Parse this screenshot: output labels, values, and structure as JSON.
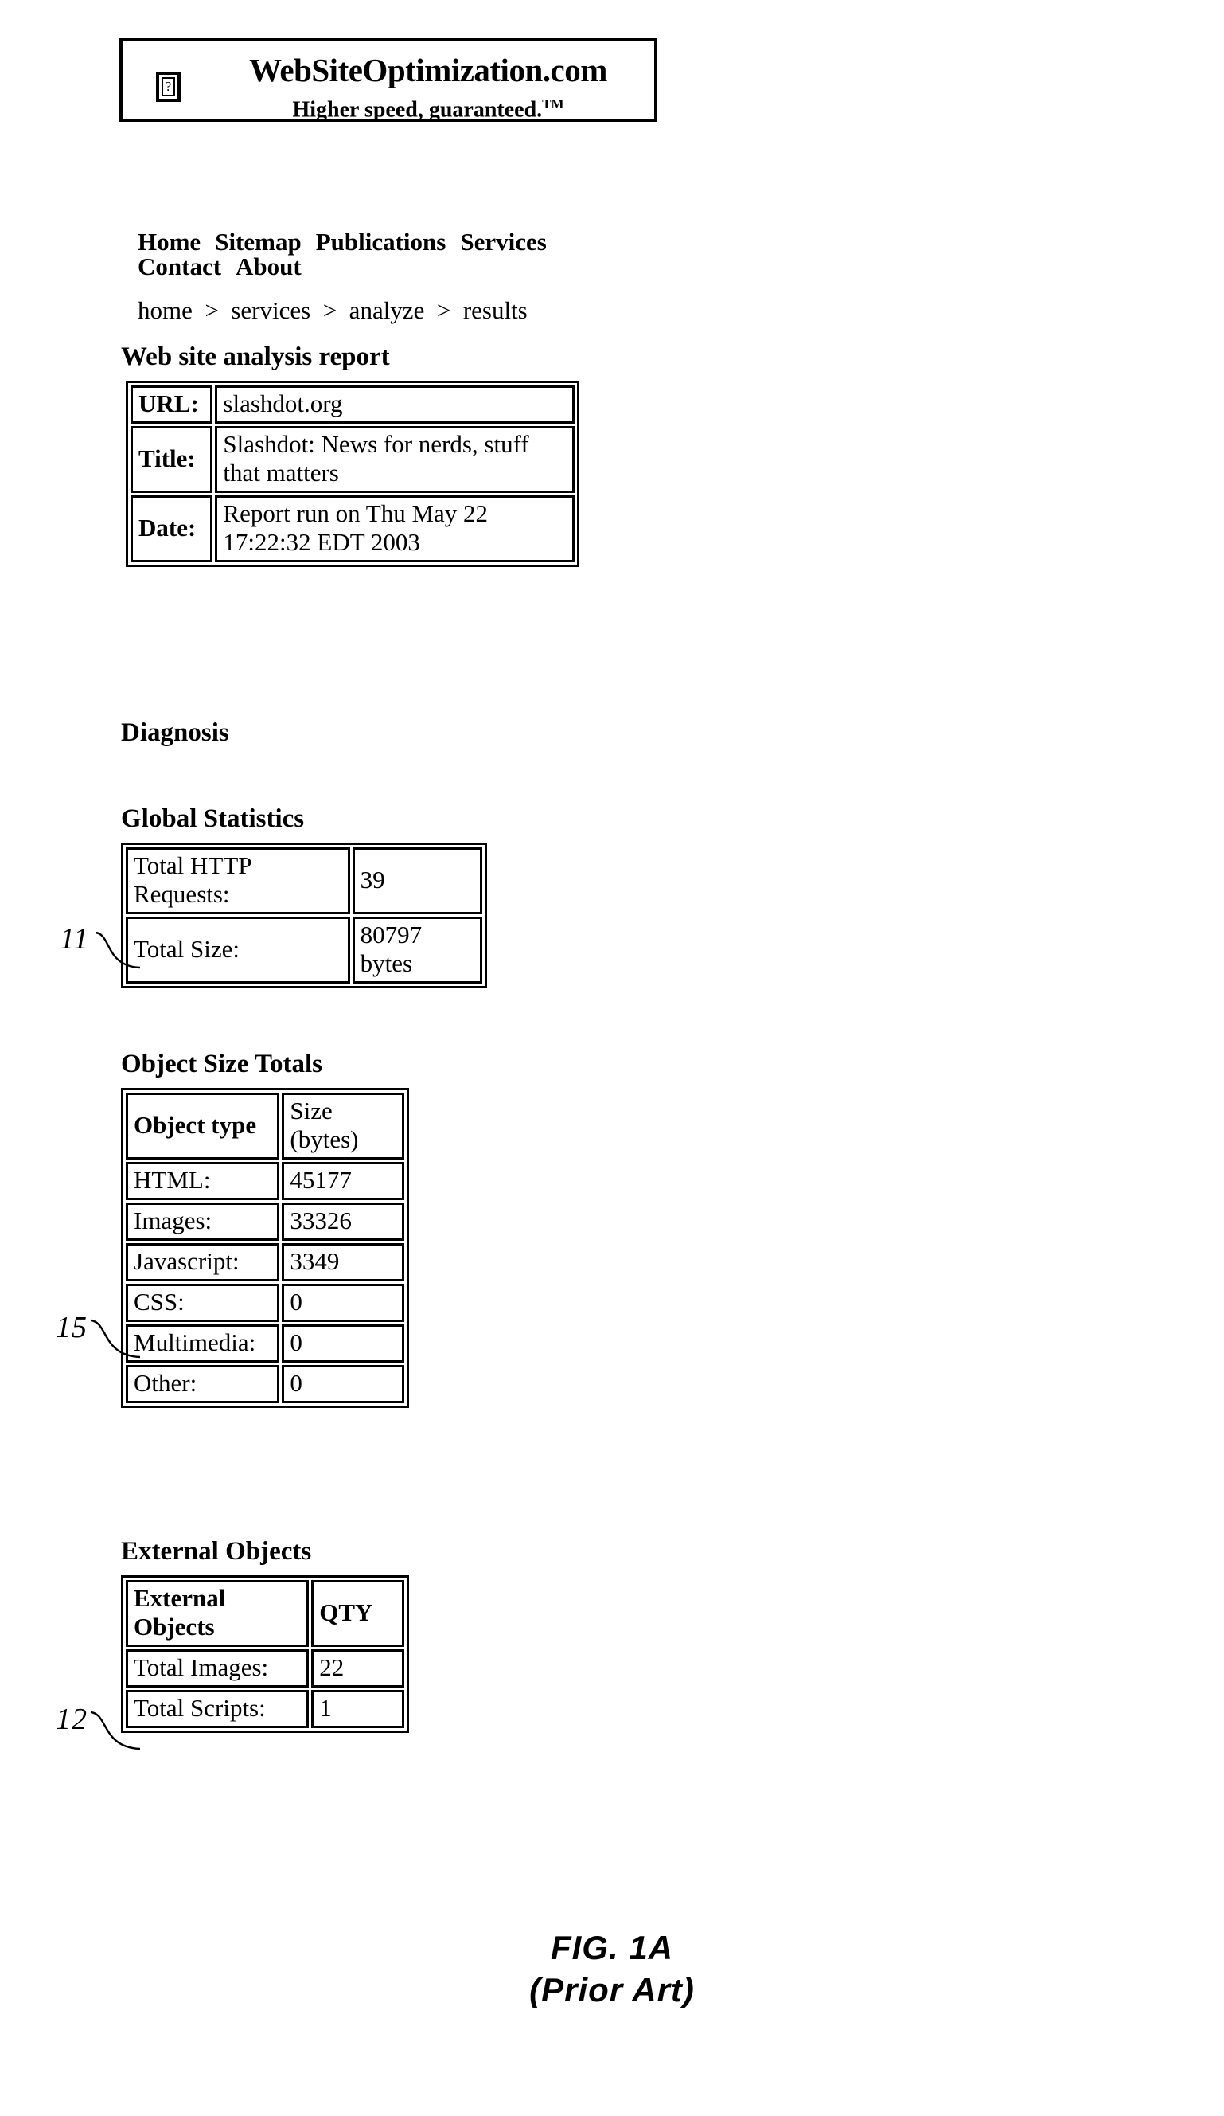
{
  "figure": {
    "label": "FIG. 1A",
    "sublabel": "(Prior Art)"
  },
  "banner": {
    "logo_icon": "broken-image-placeholder-icon",
    "logo_glyph": "?",
    "title": "WebSiteOptimization.com",
    "tagline": "Higher speed, guaranteed.",
    "tagline_mark": "TM"
  },
  "nav": {
    "items": [
      {
        "label": "Home"
      },
      {
        "label": "Sitemap"
      },
      {
        "label": "Publications"
      },
      {
        "label": "Services"
      },
      {
        "label": "Contact"
      },
      {
        "label": "About"
      }
    ]
  },
  "breadcrumb": {
    "text": "home  >  services  >  analyze  >  results",
    "items": [
      "home",
      "services",
      "analyze",
      "results"
    ],
    "separator": ">"
  },
  "headings": {
    "report": "Web site analysis report",
    "diagnosis": "Diagnosis",
    "global_statistics": "Global Statistics",
    "object_size_totals": "Object Size Totals",
    "external_objects": "External Objects"
  },
  "report_table": {
    "rows": [
      {
        "key": "URL:",
        "value": "slashdot.org"
      },
      {
        "key": "Title:",
        "value": "Slashdot: News for nerds, stuff that matters"
      },
      {
        "key": "Date:",
        "value": "Report run on Thu May 22 17:22:32 EDT 2003"
      }
    ]
  },
  "global_statistics": {
    "ref": "11",
    "rows": [
      {
        "key": "Total HTTP Requests:",
        "value": "39"
      },
      {
        "key": "Total Size:",
        "value": "80797 bytes"
      }
    ]
  },
  "object_size_totals": {
    "ref": "15",
    "header": {
      "key": "Object type",
      "value": "Size (bytes)"
    },
    "rows": [
      {
        "key": "HTML:",
        "value": "45177"
      },
      {
        "key": "Images:",
        "value": "33326"
      },
      {
        "key": "Javascript:",
        "value": "3349"
      },
      {
        "key": "CSS:",
        "value": "0"
      },
      {
        "key": "Multimedia:",
        "value": "0"
      },
      {
        "key": "Other:",
        "value": "0"
      }
    ]
  },
  "external_objects": {
    "ref": "12",
    "header": {
      "key": "External Objects",
      "value": "QTY"
    },
    "rows": [
      {
        "key": "Total Images:",
        "value": "22"
      },
      {
        "key": "Total Scripts:",
        "value": "1"
      }
    ]
  }
}
